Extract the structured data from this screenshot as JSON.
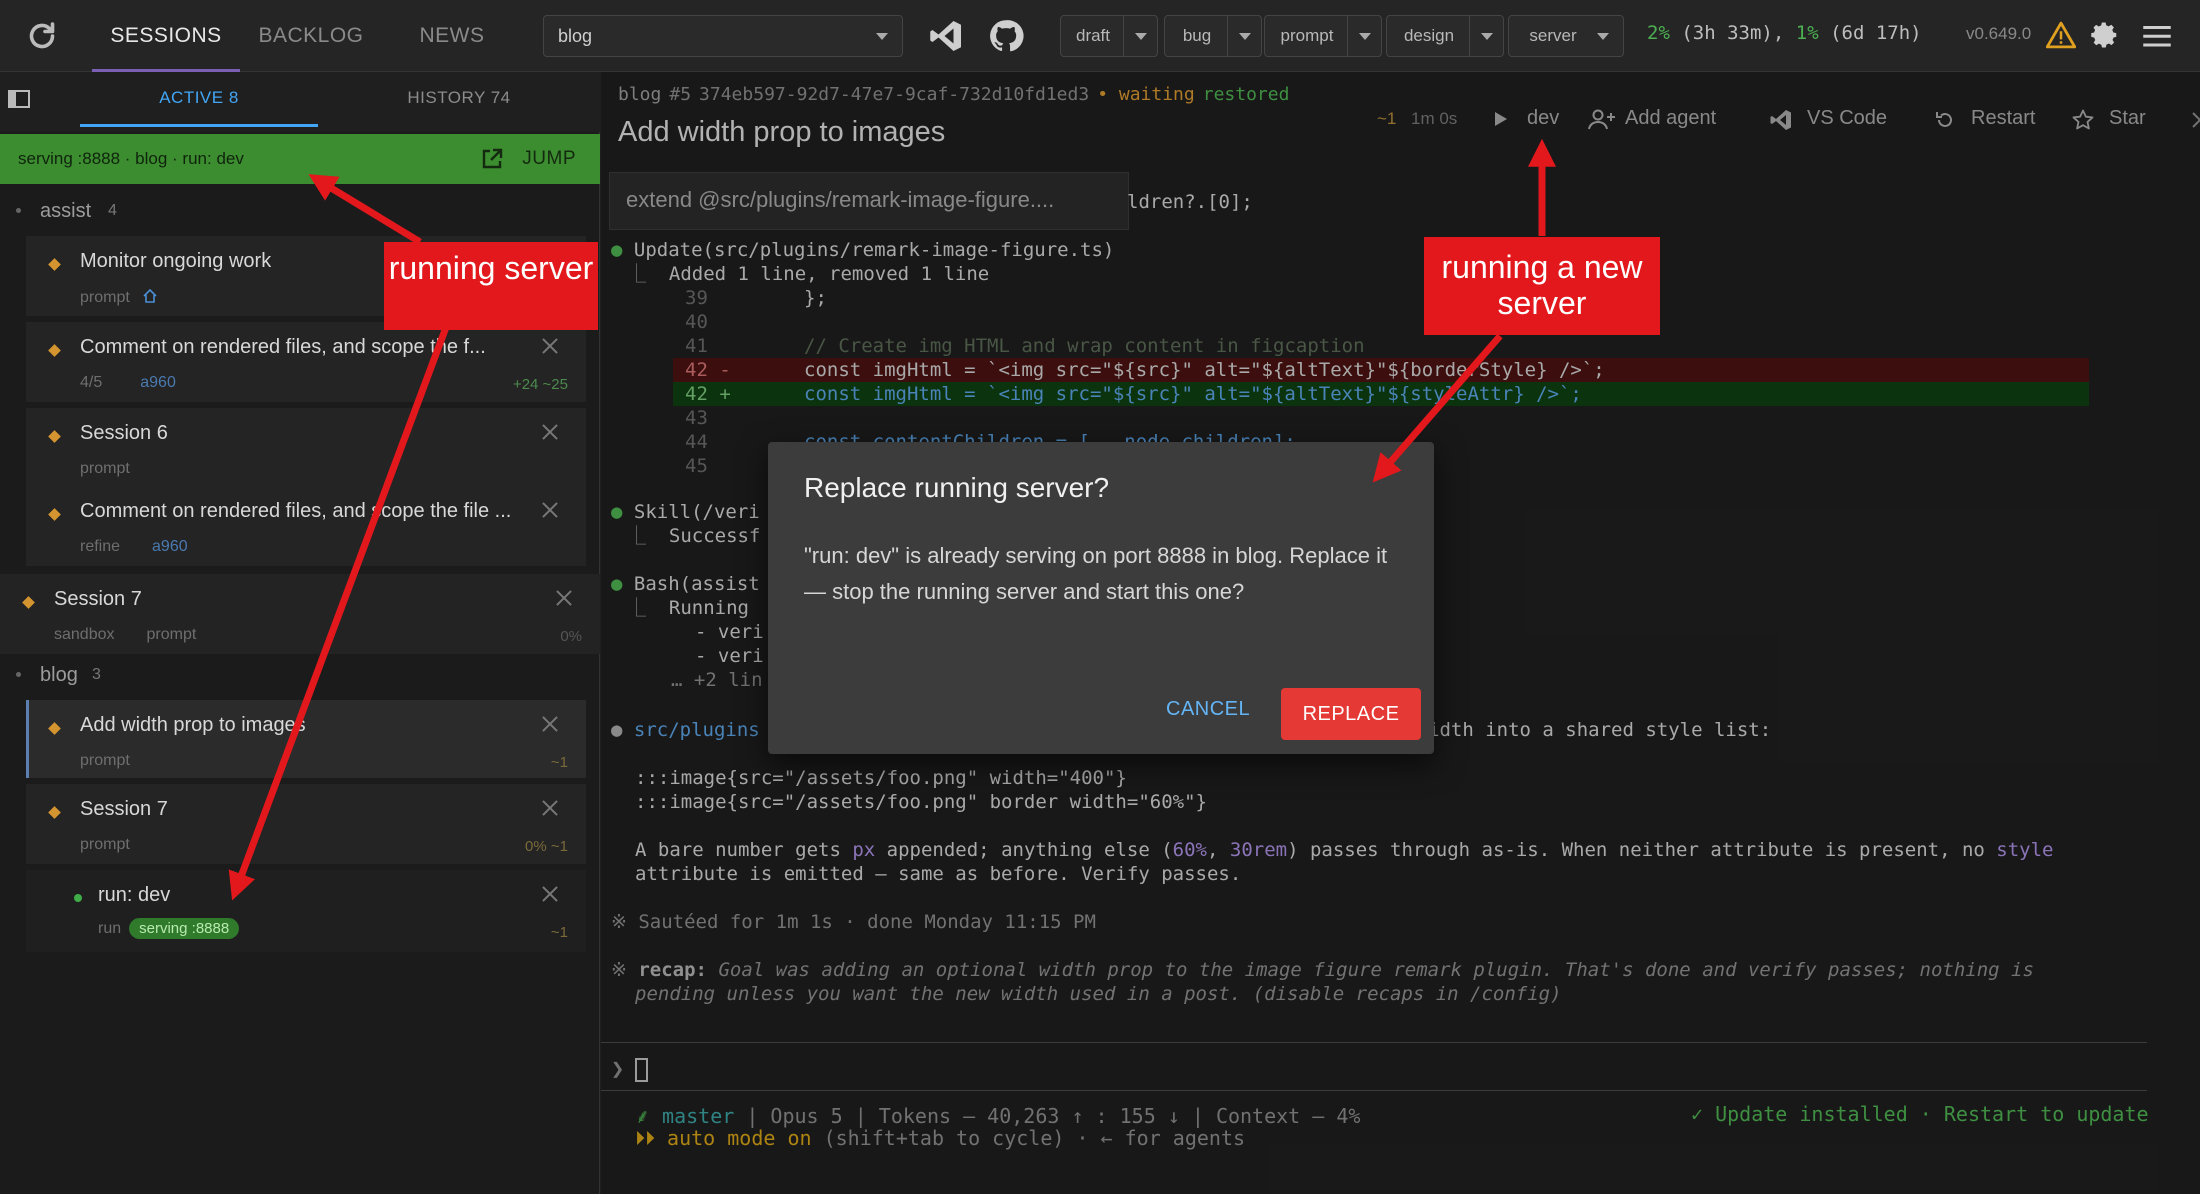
{
  "topbar": {
    "tabs": [
      {
        "label": "SESSIONS",
        "active": true
      },
      {
        "label": "BACKLOG",
        "active": false
      },
      {
        "label": "NEWS",
        "active": false
      }
    ],
    "project_select": "blog",
    "chips": [
      {
        "label": "draft"
      },
      {
        "label": "bug"
      },
      {
        "label": "prompt"
      },
      {
        "label": "design"
      },
      {
        "label": "server"
      }
    ],
    "usage_pct1": "2%",
    "usage_time1": "(3h 33m),",
    "usage_pct2": "1%",
    "usage_time2": "(6d 17h)",
    "version": "v0.649.0"
  },
  "sidebar": {
    "tabs": [
      {
        "label": "ACTIVE 8",
        "active": true
      },
      {
        "label": "HISTORY 74",
        "active": false
      }
    ],
    "serving_bar": {
      "text": "serving :8888 · blog · run: dev",
      "jump_label": "JUMP"
    },
    "groups": [
      {
        "name": "assist",
        "count": "4"
      },
      {
        "name": "blog",
        "count": "3"
      }
    ],
    "sessions": [
      {
        "title": "Monitor ongoing work",
        "meta": "prompt",
        "right": ""
      },
      {
        "title": "Comment on rendered files, and scope the f...",
        "meta1": "4/5",
        "meta2": "a960",
        "right": "+24 ~25"
      },
      {
        "title": "Session 6",
        "meta": "prompt",
        "right": ""
      },
      {
        "title": "Comment on rendered files, and scope the file ...",
        "meta1": "refine",
        "meta2": "a960",
        "right": ""
      },
      {
        "title": "Session 7",
        "meta1": "sandbox",
        "meta2": "prompt",
        "right": "0%"
      },
      {
        "title": "Add width prop to images",
        "meta": "prompt",
        "right": "~1"
      },
      {
        "title": "Session 7",
        "meta": "prompt",
        "right": "0%  ~1"
      },
      {
        "title": "run: dev",
        "meta": "run",
        "badge": "serving :8888",
        "right": "~1"
      }
    ]
  },
  "header": {
    "project": "blog",
    "number": "#5",
    "hash": "374eb597-92d7-47e7-9caf-732d10fd1ed3",
    "status": "• waiting",
    "restored": "restored",
    "title": "Add width prop to images",
    "diff": "~1",
    "elapsed": "1m 0s",
    "actions": {
      "run": "dev",
      "add_agent": "Add agent",
      "vscode": "VS Code",
      "restart": "Restart",
      "star": "Star"
    }
  },
  "prompt_preview": "extend @src/plugins/remark-image-figure....",
  "terminal": {
    "l0": "ldren?.[0];",
    "update_head": "Update(src/plugins/remark-image-figure.ts)",
    "update_sub": "Added 1 line, removed 1 line",
    "n39": "39",
    "c39": "};",
    "n40": "40",
    "n41": "41",
    "c41": "// Create img HTML and wrap content in figcaption",
    "n42a": "42 -",
    "c42a": "const imgHtml = `<img src=\"${src}\" alt=\"${altText}\"${borderStyle} />`;",
    "n42b": "42 +",
    "c42b": "const imgHtml = `<img src=\"${src}\" alt=\"${altText}\"${styleAttr} />`;",
    "n43": "43",
    "n44": "44",
    "c44": "const contentChildren = [...node.children];",
    "n45": "45",
    "skill": "Skill(/veri",
    "skill_sub": "Successf",
    "bash": "Bash(assist",
    "bash_sub": "Running",
    "bash_a": "- veri",
    "bash_b": "- veri",
    "bash_more": "… +2 lin",
    "src_head": "src/plugins",
    "src_tail": "idth into a shared style list:",
    "ex1": ":::image{src=\"/assets/foo.png\" width=\"400\"}",
    "ex2": ":::image{src=\"/assets/foo.png\" border width=\"60%\"}",
    "p1a": "A bare number gets ",
    "p1b": "px",
    "p1c": " appended; anything else (",
    "p1d": "60%",
    "p1e": ", ",
    "p1f": "30rem",
    "p1g": ") passes through as-is. When neither attribute is present, no ",
    "p1h": "style",
    "p2": "attribute is emitted — same as before. Verify passes.",
    "sauteed": "Sautéed for 1m 1s · done Monday 11:15 PM",
    "recap_label": "recap:",
    "recap1": " Goal was adding an optional width prop to the image figure remark plugin. That's done and verify passes; nothing is",
    "recap2": "pending unless you want the new width used in a post. (disable recaps in /config)",
    "prompt_char": "❯"
  },
  "statusline": {
    "branch": "master",
    "rest": " | Opus 5 | Tokens — 40,263 ↑ : 155 ↓ | Context — 4%",
    "update": "✓ Update installed · Restart to update",
    "auto": "⏵⏵ auto mode on",
    "auto_rest": " (shift+tab to cycle) · ← for agents"
  },
  "dialog": {
    "title": "Replace running server?",
    "body": "\"run: dev\" is already serving on port 8888 in blog. Replace it — stop the running server and start this one?",
    "cancel": "CANCEL",
    "replace": "REPLACE"
  },
  "annotations": {
    "left": "running server",
    "right": "running a new server"
  },
  "colors": {
    "annotation_red": "#e2181c",
    "serving_green": "#3c8d2f",
    "replace_red": "#e53935",
    "accent_blue": "#42a5f5",
    "waiting_orange": "#d49530"
  }
}
